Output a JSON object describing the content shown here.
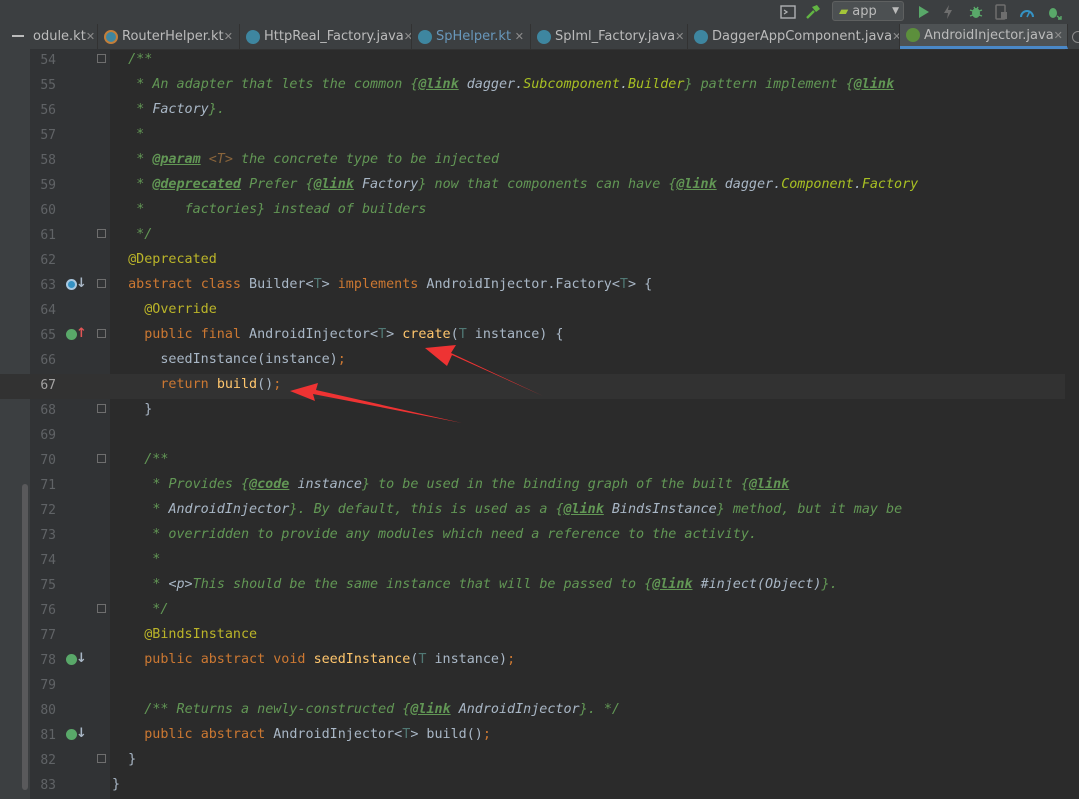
{
  "toolbar": {
    "run_config": "app",
    "icons": [
      "terminal-icon",
      "hammer-icon",
      "run-icon",
      "apply-changes-icon",
      "debug-icon",
      "device-icon",
      "profiler-icon",
      "attach-debugger-icon"
    ]
  },
  "tabs": [
    {
      "label": "odule.kt",
      "icon": "kotlin-file-icon",
      "active": false
    },
    {
      "label": "RouterHelper.kt",
      "icon": "kotlin-file-icon",
      "active": false
    },
    {
      "label": "HttpReal_Factory.java",
      "icon": "class-icon",
      "active": false
    },
    {
      "label": "SpHelper.kt",
      "icon": "class-icon",
      "active": false
    },
    {
      "label": "SpIml_Factory.java",
      "icon": "class-icon",
      "active": false
    },
    {
      "label": "DaggerAppComponent.java",
      "icon": "class-icon",
      "active": false
    },
    {
      "label": "AndroidInjector.java",
      "icon": "interface-icon",
      "active": true
    }
  ],
  "colors": {
    "editor_bg": "#2b2b2b",
    "keyword": "#cc7832",
    "annotation": "#bbb529",
    "method": "#ffc66d",
    "doc_comment": "#629755",
    "arrow": "#ee3333",
    "active_tab_underline": "#4a88c7"
  },
  "lines": [
    {
      "n": "54",
      "t": "  /**"
    },
    {
      "n": "55",
      "t": "   * An adapter that lets the common {@link dagger.Subcomponent.Builder} pattern implement {@link"
    },
    {
      "n": "56",
      "t": "   * Factory}."
    },
    {
      "n": "57",
      "t": "   *"
    },
    {
      "n": "58",
      "t": "   * @param <T> the concrete type to be injected"
    },
    {
      "n": "59",
      "t": "   * @deprecated Prefer {@link Factory} now that components can have {@link dagger.Component.Factory"
    },
    {
      "n": "60",
      "t": "   *     factories} instead of builders"
    },
    {
      "n": "61",
      "t": "   */"
    },
    {
      "n": "62",
      "t": "  @Deprecated"
    },
    {
      "n": "63",
      "t": "  abstract class Builder<T> implements AndroidInjector.Factory<T> {"
    },
    {
      "n": "64",
      "t": "    @Override"
    },
    {
      "n": "65",
      "t": "    public final AndroidInjector<T> create(T instance) {"
    },
    {
      "n": "66",
      "t": "      seedInstance(instance);"
    },
    {
      "n": "67",
      "t": "      return build();"
    },
    {
      "n": "68",
      "t": "    }"
    },
    {
      "n": "69",
      "t": ""
    },
    {
      "n": "70",
      "t": "    /**"
    },
    {
      "n": "71",
      "t": "     * Provides {@code instance} to be used in the binding graph of the built {@link"
    },
    {
      "n": "72",
      "t": "     * AndroidInjector}. By default, this is used as a {@link BindsInstance} method, but it may be"
    },
    {
      "n": "73",
      "t": "     * overridden to provide any modules which need a reference to the activity."
    },
    {
      "n": "74",
      "t": "     *"
    },
    {
      "n": "75",
      "t": "     * <p>This should be the same instance that will be passed to {@link #inject(Object)}."
    },
    {
      "n": "76",
      "t": "     */"
    },
    {
      "n": "77",
      "t": "    @BindsInstance"
    },
    {
      "n": "78",
      "t": "    public abstract void seedInstance(T instance);"
    },
    {
      "n": "79",
      "t": ""
    },
    {
      "n": "80",
      "t": "    /** Returns a newly-constructed {@link AndroidInjector}. */"
    },
    {
      "n": "81",
      "t": "    public abstract AndroidInjector<T> build();"
    },
    {
      "n": "82",
      "t": "  }"
    },
    {
      "n": "83",
      "t": "}"
    }
  ],
  "current_line": "67",
  "gutter_icons": [
    {
      "line": "63",
      "icon": "implemented-by-icon"
    },
    {
      "line": "65",
      "icon": "implements-method-icon"
    },
    {
      "line": "78",
      "icon": "implemented-method-icon"
    },
    {
      "line": "81",
      "icon": "implemented-method-icon"
    }
  ]
}
